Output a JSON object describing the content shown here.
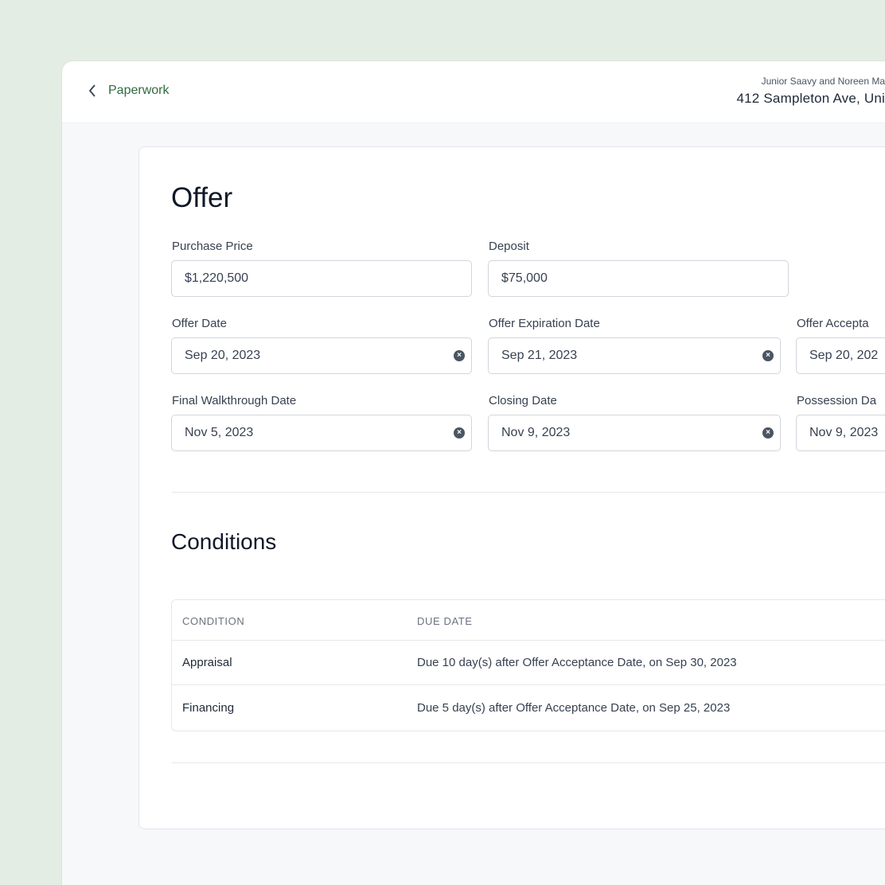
{
  "header": {
    "back_label": "Paperwork",
    "client_names": "Junior Saavy and Noreen Ma",
    "address": "412 Sampleton Ave, Uni"
  },
  "offer": {
    "title": "Offer",
    "purchase_price": {
      "label": "Purchase Price",
      "value": "$1,220,500"
    },
    "deposit": {
      "label": "Deposit",
      "value": "$75,000"
    },
    "offer_date": {
      "label": "Offer Date",
      "value": "Sep 20, 2023"
    },
    "offer_expiration_date": {
      "label": "Offer Expiration Date",
      "value": "Sep 21, 2023"
    },
    "offer_acceptance_date": {
      "label": "Offer Accepta",
      "value": "Sep 20, 202"
    },
    "final_walkthrough_date": {
      "label": "Final Walkthrough Date",
      "value": "Nov 5, 2023"
    },
    "closing_date": {
      "label": "Closing Date",
      "value": "Nov 9, 2023"
    },
    "possession_date": {
      "label": "Possession Da",
      "value": "Nov 9, 2023"
    }
  },
  "conditions": {
    "title": "Conditions",
    "columns": [
      "CONDITION",
      "DUE DATE"
    ],
    "rows": [
      {
        "condition": "Appraisal",
        "due": "Due 10 day(s) after Offer Acceptance Date, on Sep 30, 2023"
      },
      {
        "condition": "Financing",
        "due": "Due 5 day(s) after Offer Acceptance Date, on Sep 25, 2023"
      }
    ]
  },
  "colors": {
    "brand": "#2f6b3f",
    "background": "#e3ede3"
  }
}
